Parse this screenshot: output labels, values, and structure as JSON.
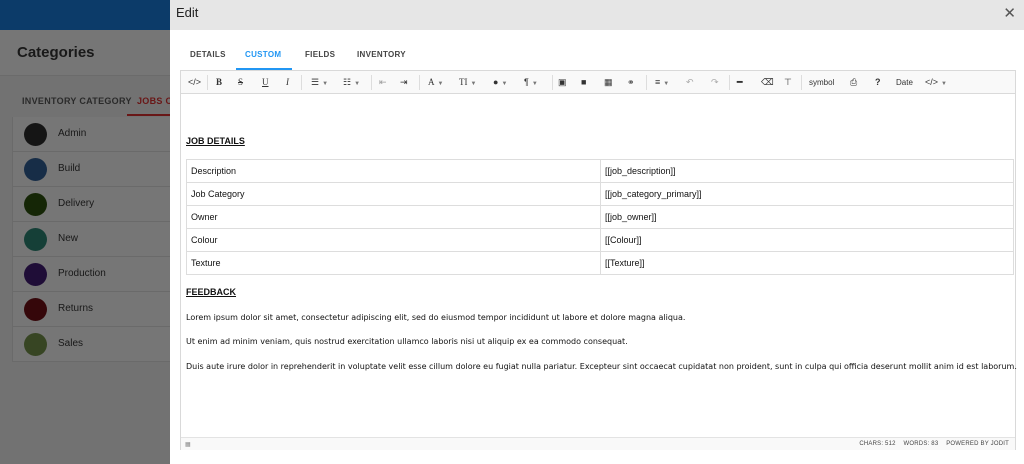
{
  "background": {
    "page_title": "Categories",
    "tabs": [
      "INVENTORY CATEGORY",
      "JOBS CA"
    ],
    "categories": [
      {
        "label": "Admin",
        "color": "#2b2b2b"
      },
      {
        "label": "Build",
        "color": "#2f5a8f"
      },
      {
        "label": "Delivery",
        "color": "#2b4d0c"
      },
      {
        "label": "New",
        "color": "#2a7f6f"
      },
      {
        "label": "Production",
        "color": "#3f1b6e"
      },
      {
        "label": "Returns",
        "color": "#6b0f14"
      },
      {
        "label": "Sales",
        "color": "#6e8a46"
      }
    ]
  },
  "modal": {
    "title": "Edit",
    "close_icon": "close-icon",
    "tabs": [
      "DETAILS",
      "CUSTOM",
      "FIELDS",
      "INVENTORY"
    ],
    "active_tab": "CUSTOM"
  },
  "toolbar": {
    "font_btn": "A",
    "size_btn": "TI",
    "para_btn": "¶",
    "symbol": "symbol",
    "help": "?",
    "date": "Date"
  },
  "document": {
    "job_heading": "JOB DETAILS",
    "table": [
      [
        "Description",
        "[[job_description]]"
      ],
      [
        "Job Category",
        "[[job_category_primary]]"
      ],
      [
        "Owner",
        "[[job_owner]]"
      ],
      [
        "Colour",
        "[[Colour]]"
      ],
      [
        "Texture",
        "[[Texture]]"
      ]
    ],
    "feedback_heading": "FEEDBACK",
    "paragraphs": [
      "Lorem ipsum dolor sit amet, consectetur adipiscing elit, sed do eiusmod tempor incididunt ut labore et dolore magna aliqua.",
      "Ut enim ad minim veniam, quis nostrud exercitation ullamco laboris nisi ut aliquip ex ea commodo consequat.",
      "Duis aute irure dolor in reprehenderit in voluptate velit esse cillum dolore eu fugiat nulla pariatur. Excepteur sint occaecat cupidatat non proident, sunt in culpa qui officia deserunt mollit anim id est laborum."
    ]
  },
  "status": {
    "chars": "CHARS: 512",
    "words": "WORDS: 83",
    "powered": "POWERED BY JODIT"
  }
}
